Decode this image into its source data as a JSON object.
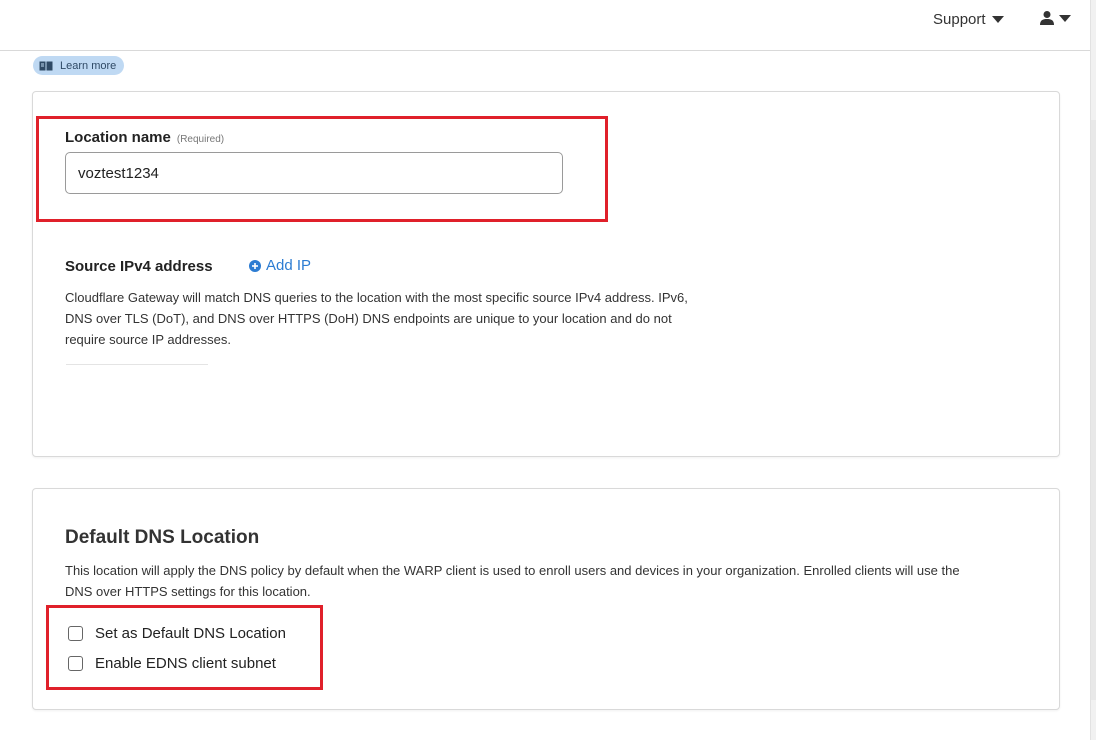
{
  "header": {
    "support_label": "Support"
  },
  "learn_more": {
    "label": "Learn more"
  },
  "location_card": {
    "name_label": "Location name",
    "name_required": "(Required)",
    "name_value": "voztest1234",
    "source_label": "Source IPv4 address",
    "add_ip_label": "Add IP",
    "source_description_lines": [
      "Cloudflare Gateway will match DNS queries to the location with the most specific source IPv4 address. IPv6,",
      "DNS over TLS (DoT), and DNS over HTTPS (DoH) DNS endpoints are unique to your location and do not",
      "require source IP addresses."
    ]
  },
  "default_dns_card": {
    "title": "Default DNS Location",
    "description_lines": [
      "This location will apply the DNS policy by default when the WARP client is used to enroll users and devices in your organization. Enrolled clients will use the",
      "DNS over HTTPS settings for this location."
    ],
    "checkboxes": [
      {
        "label": "Set as Default DNS Location",
        "checked": false
      },
      {
        "label": "Enable EDNS client subnet",
        "checked": false
      }
    ]
  },
  "colors": {
    "highlight": "#e0202a",
    "link": "#2c7cd2",
    "badge_bg": "#bfd9f3"
  }
}
